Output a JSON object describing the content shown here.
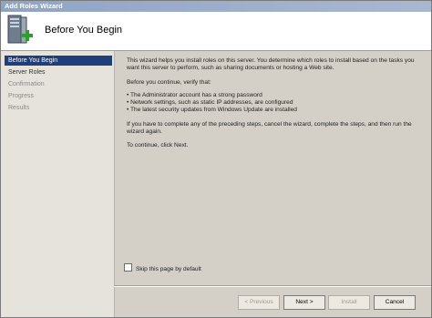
{
  "window": {
    "title": "Add Roles Wizard"
  },
  "header": {
    "title": "Before You Begin",
    "icon": "server-add-icon"
  },
  "sidebar": {
    "items": [
      {
        "label": "Before You Begin",
        "state": "active"
      },
      {
        "label": "Server Roles",
        "state": "enabled"
      },
      {
        "label": "Confirmation",
        "state": "disabled"
      },
      {
        "label": "Progress",
        "state": "disabled"
      },
      {
        "label": "Results",
        "state": "disabled"
      }
    ]
  },
  "content": {
    "intro": "This wizard helps you install roles on this server. You determine which roles to install based on the tasks you want this server to perform, such as sharing documents or hosting a Web site.",
    "verify": "Before you continue, verify that:",
    "bullets": [
      "• The Administrator account has a strong password",
      "• Network settings, such as static IP addresses, are configured",
      "• The latest security updates from Windows Update are installed"
    ],
    "cancel_note": "If you have to complete any of the preceding steps, cancel the wizard, complete the steps, and then run the wizard again.",
    "continue_note": "To continue, click Next."
  },
  "skip_checkbox": {
    "label": "Skip this page by default",
    "checked": false
  },
  "buttons": {
    "previous": "< Previous",
    "next": "Next >",
    "install": "Install",
    "cancel": "Cancel"
  },
  "colors": {
    "selected_nav": "#1f3f7a",
    "dialog_bg": "#d4d0c8"
  }
}
